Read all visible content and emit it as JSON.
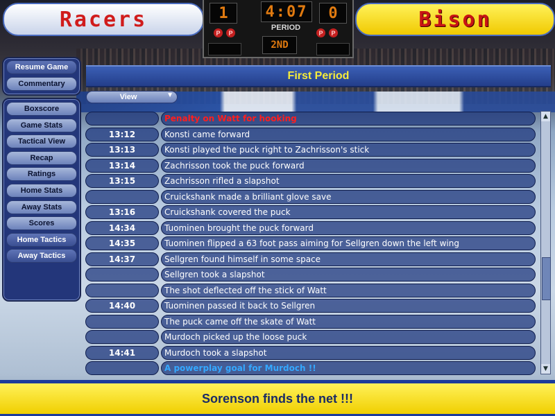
{
  "header": {
    "home_team": "Racers",
    "away_team": "Bison",
    "home_score": "1",
    "away_score": "0",
    "clock": "4:07",
    "period_label": "PERIOD",
    "period_value": "2ND",
    "penalty_indicator": "P"
  },
  "nav": {
    "top": [
      "Resume Game",
      "Commentary"
    ],
    "bottom": [
      "Boxscore",
      "Game Stats",
      "Tactical View",
      "Recap",
      "Ratings",
      "Home Stats",
      "Away Stats",
      "Scores",
      "Home Tactics",
      "Away Tactics"
    ]
  },
  "panel": {
    "title": "First Period",
    "view_label": "View"
  },
  "events": [
    {
      "time": "",
      "text": "Penalty on Watt for hooking",
      "kind": "penalty"
    },
    {
      "time": "13:12",
      "text": "Konsti came forward",
      "kind": "normal"
    },
    {
      "time": "13:13",
      "text": "Konsti played the puck right to Zachrisson's stick",
      "kind": "normal"
    },
    {
      "time": "13:14",
      "text": "Zachrisson took the puck forward",
      "kind": "normal"
    },
    {
      "time": "13:15",
      "text": "Zachrisson rifled a slapshot",
      "kind": "normal"
    },
    {
      "time": "",
      "text": "Cruickshank made a brilliant glove save",
      "kind": "normal"
    },
    {
      "time": "13:16",
      "text": "Cruickshank covered the puck",
      "kind": "normal"
    },
    {
      "time": "14:34",
      "text": "Tuominen brought the puck forward",
      "kind": "normal"
    },
    {
      "time": "14:35",
      "text": "Tuominen flipped a 63 foot pass aiming for Sellgren down the left wing",
      "kind": "normal"
    },
    {
      "time": "14:37",
      "text": "Sellgren found himself in some space",
      "kind": "normal"
    },
    {
      "time": "",
      "text": "Sellgren took a slapshot",
      "kind": "normal"
    },
    {
      "time": "",
      "text": "The shot deflected off the stick of Watt",
      "kind": "normal"
    },
    {
      "time": "14:40",
      "text": "Tuominen passed it back to Sellgren",
      "kind": "normal"
    },
    {
      "time": "",
      "text": "The puck came off the skate of Watt",
      "kind": "normal"
    },
    {
      "time": "",
      "text": "Murdoch picked up the loose puck",
      "kind": "normal"
    },
    {
      "time": "14:41",
      "text": "Murdoch took a slapshot",
      "kind": "normal"
    },
    {
      "time": "",
      "text": "A powerplay goal for Murdoch !!",
      "kind": "goal"
    }
  ],
  "footer": {
    "message": "Sorenson finds the net !!!"
  },
  "colors": {
    "title_text": "#f6ec3a",
    "penalty_text": "#ff1e1e",
    "goal_text": "#35a8ff",
    "footer_bg": "#f0cf00"
  }
}
